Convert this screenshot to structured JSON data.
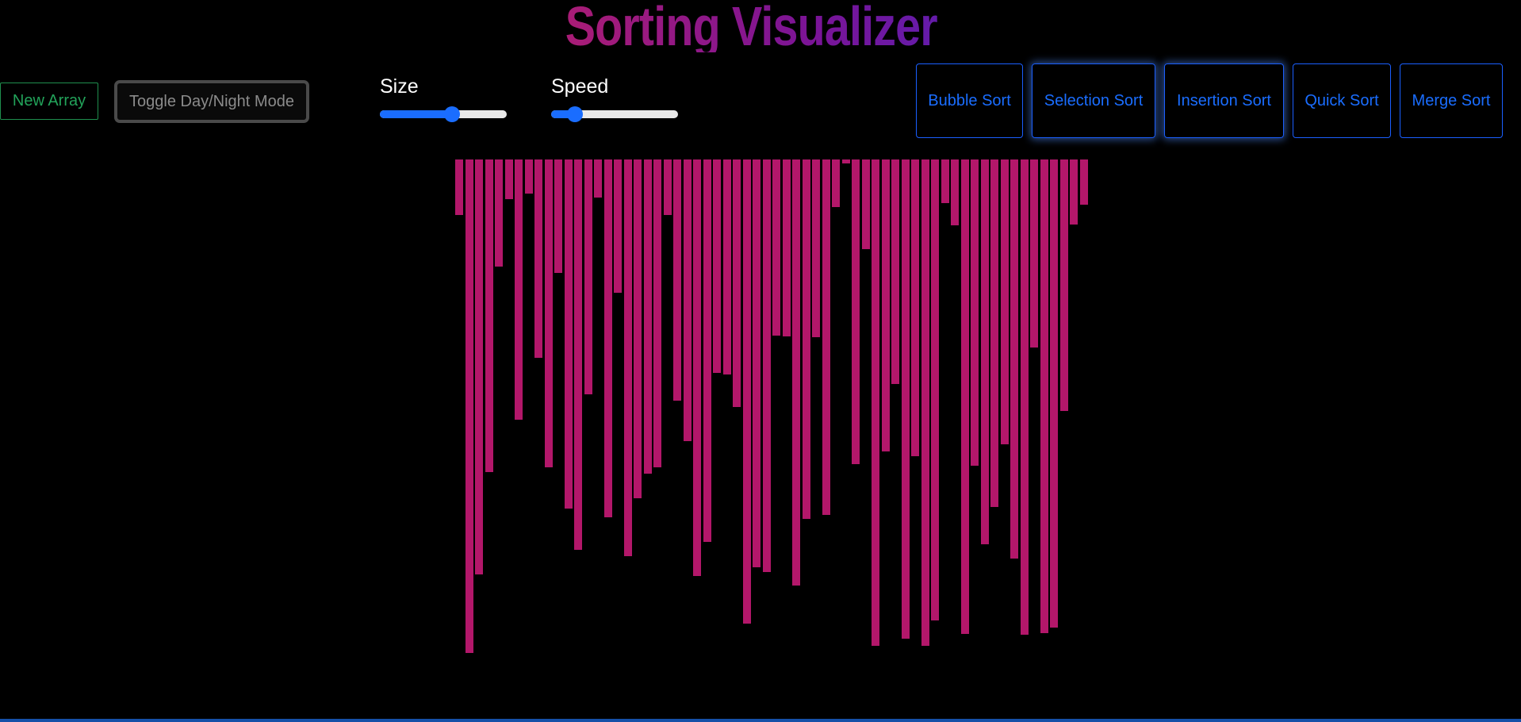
{
  "title": "Sorting Visualizer",
  "controls": {
    "new_array": "New Array",
    "toggle_mode": "Toggle Day/Night Mode",
    "size_label": "Size",
    "speed_label": "Speed",
    "size_value": 0.57,
    "speed_value": 0.19
  },
  "algorithms": [
    "Bubble Sort",
    "Selection Sort",
    "Insertion Sort",
    "Quick Sort",
    "Merge Sort"
  ],
  "colors": {
    "bar": "#b3176a",
    "accent": "#1a6dff",
    "new_array": "#22a35a"
  },
  "array": [
    70,
    622,
    523,
    394,
    135,
    50,
    328,
    43,
    250,
    388,
    143,
    440,
    492,
    296,
    48,
    451,
    168,
    500,
    427,
    396,
    388,
    70,
    304,
    355,
    525,
    482,
    269,
    271,
    312,
    585,
    514,
    520,
    222,
    223,
    537,
    453,
    224,
    448,
    60,
    5,
    384,
    113,
    613,
    368,
    283,
    604,
    374,
    613,
    581,
    55,
    83,
    598,
    386,
    485,
    438,
    359,
    503,
    599,
    237,
    597,
    590,
    317,
    82,
    57
  ]
}
